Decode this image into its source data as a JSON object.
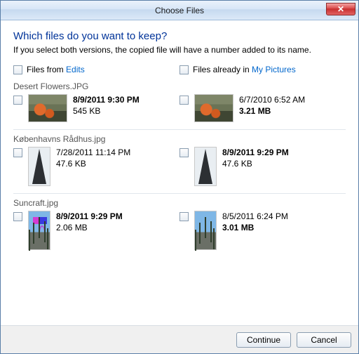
{
  "window": {
    "title": "Choose Files",
    "close_glyph": "✕"
  },
  "heading": "Which files do you want to keep?",
  "subline": "If you select both versions, the copied file will have a number added to its name.",
  "top_checks": {
    "left_prefix": "Files from ",
    "left_link": "Edits",
    "right_prefix": "Files already in ",
    "right_link": "My Pictures"
  },
  "groups": [
    {
      "name": "Desert Flowers.JPG",
      "left": {
        "date": "8/9/2011 9:30 PM",
        "size": "545 KB",
        "date_bold": true,
        "size_bold": false
      },
      "right": {
        "date": "6/7/2010 6:52 AM",
        "size": "3.21 MB",
        "date_bold": false,
        "size_bold": true
      }
    },
    {
      "name": "Københavns Rådhus.jpg",
      "left": {
        "date": "7/28/2011 11:14 PM",
        "size": "47.6 KB",
        "date_bold": false,
        "size_bold": false
      },
      "right": {
        "date": "8/9/2011 9:29 PM",
        "size": "47.6 KB",
        "date_bold": true,
        "size_bold": false
      }
    },
    {
      "name": "Suncraft.jpg",
      "left": {
        "date": "8/9/2011 9:29 PM",
        "size": "2.06 MB",
        "date_bold": true,
        "size_bold": false
      },
      "right": {
        "date": "8/5/2011 6:24 PM",
        "size": "3.01 MB",
        "date_bold": false,
        "size_bold": true
      }
    }
  ],
  "footer": {
    "continue": "Continue",
    "cancel": "Cancel"
  }
}
